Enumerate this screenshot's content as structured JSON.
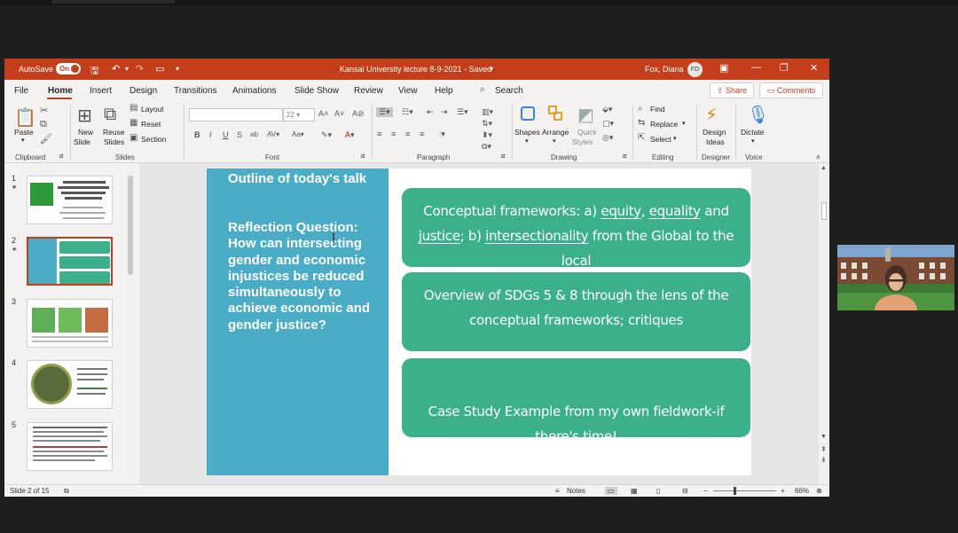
{
  "titlebar": {
    "autosave_label": "AutoSave",
    "autosave_state": "On",
    "document_title": "Kansai University lecture 8-9-2021 - Saved",
    "user_name": "Fox, Diana",
    "user_initials": "FD"
  },
  "tabs": [
    "File",
    "Home",
    "Insert",
    "Design",
    "Transitions",
    "Animations",
    "Slide Show",
    "Review",
    "View",
    "Help"
  ],
  "search_label": "Search",
  "share_label": "Share",
  "comments_label": "Comments",
  "ribbon": {
    "clipboard": {
      "paste": "Paste",
      "group": "Clipboard"
    },
    "slides": {
      "new_slide_1": "New",
      "new_slide_2": "Slide",
      "reuse_1": "Reuse",
      "reuse_2": "Slides",
      "layout": "Layout",
      "reset": "Reset",
      "section": "Section",
      "group": "Slides"
    },
    "font": {
      "size": "22",
      "group": "Font"
    },
    "paragraph": {
      "group": "Paragraph"
    },
    "drawing": {
      "shapes": "Shapes",
      "arrange": "Arrange",
      "quick_1": "Quick",
      "quick_2": "Styles",
      "group": "Drawing"
    },
    "editing": {
      "find": "Find",
      "replace": "Replace",
      "select": "Select",
      "group": "Editing"
    },
    "designer": {
      "ideas_1": "Design",
      "ideas_2": "Ideas",
      "group": "Designer"
    },
    "voice": {
      "dictate": "Dictate",
      "group": "Voice"
    }
  },
  "thumbnails": [
    "1",
    "2",
    "3",
    "4",
    "5"
  ],
  "slide": {
    "title": "Outline of today's talk",
    "question": "Reflection Question: How can intersecting gender and economic injustices be reduced simultaneously to achieve economic and gender justice?",
    "box1": {
      "pre": "Conceptual frameworks: a) ",
      "w1": "equity",
      "c1": ", ",
      "w2": "equality",
      "c2": " and ",
      "w3": "justice",
      "c3": "; b) ",
      "w4": "intersectionality",
      "post": " from the Global to the local"
    },
    "box2": "Overview of SDGs 5 & 8 through the lens of the conceptual frameworks; critiques",
    "box3": "Case Study Example from my own fieldwork-if there's time!"
  },
  "statusbar": {
    "slide_info": "Slide 2 of 15",
    "notes": "Notes",
    "zoom": "66%"
  },
  "colors": {
    "accent": "#c43e1c",
    "slide_left": "#4bacc6",
    "slide_box": "#3cb08a"
  }
}
